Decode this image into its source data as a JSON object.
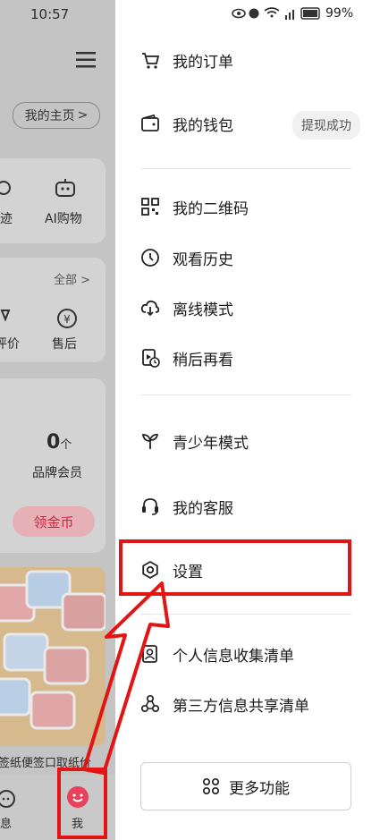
{
  "status": {
    "time": "10:57",
    "battery": "99%"
  },
  "left": {
    "homepage_btn": "我的主页",
    "dynamics": "迹",
    "ai_shopping": "AI购物",
    "all": "全部",
    "review": "评价",
    "after_sale": "售后",
    "brand_count": "0",
    "brand_unit": "个",
    "brand_member": "品牌会员",
    "coins_btn": "领金币",
    "product_caption": "签纸便签口取纸价",
    "messages": "息",
    "me": "我"
  },
  "menu": {
    "orders": "我的订单",
    "wallet": "我的钱包",
    "wallet_badge": "提现成功",
    "qrcode": "我的二维码",
    "history": "观看历史",
    "offline": "离线模式",
    "later": "稍后再看",
    "youth": "青少年模式",
    "service": "我的客服",
    "settings": "设置",
    "personal_info": "个人信息收集清单",
    "third_party": "第三方信息共享清单",
    "more": "更多功能"
  },
  "colors": {
    "highlight": "#e31414",
    "accent": "#e8425a"
  }
}
